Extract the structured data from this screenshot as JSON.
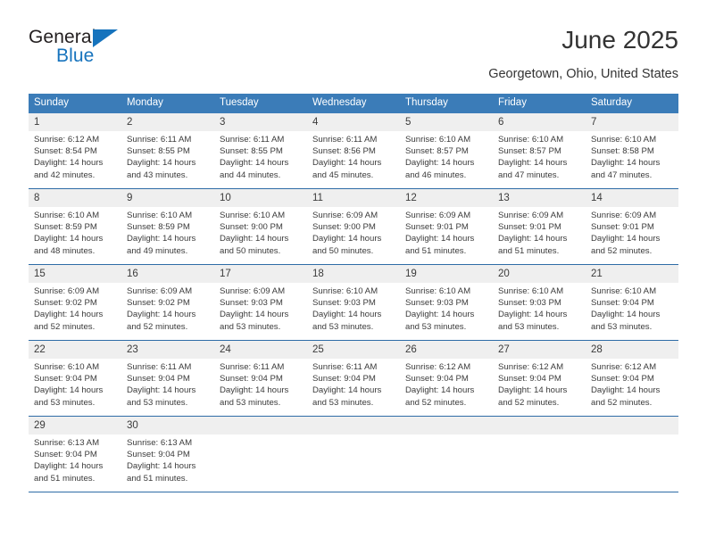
{
  "logo": {
    "word1": "General",
    "word2": "Blue",
    "triangle_color": "#1673bd",
    "icon": "blue-triangle-icon"
  },
  "header": {
    "title": "June 2025",
    "subtitle": "Georgetown, Ohio, United States"
  },
  "theme": {
    "header_blue": "#3b7cb8",
    "rule_blue": "#2e6ca6",
    "daynum_gray": "#efefef",
    "text": "#3b3b3b"
  },
  "calendar": {
    "weekday_headers": [
      "Sunday",
      "Monday",
      "Tuesday",
      "Wednesday",
      "Thursday",
      "Friday",
      "Saturday"
    ],
    "weeks": [
      [
        {
          "day": "1",
          "sunrise": "Sunrise: 6:12 AM",
          "sunset": "Sunset: 8:54 PM",
          "daylight1": "Daylight: 14 hours",
          "daylight2": "and 42 minutes."
        },
        {
          "day": "2",
          "sunrise": "Sunrise: 6:11 AM",
          "sunset": "Sunset: 8:55 PM",
          "daylight1": "Daylight: 14 hours",
          "daylight2": "and 43 minutes."
        },
        {
          "day": "3",
          "sunrise": "Sunrise: 6:11 AM",
          "sunset": "Sunset: 8:55 PM",
          "daylight1": "Daylight: 14 hours",
          "daylight2": "and 44 minutes."
        },
        {
          "day": "4",
          "sunrise": "Sunrise: 6:11 AM",
          "sunset": "Sunset: 8:56 PM",
          "daylight1": "Daylight: 14 hours",
          "daylight2": "and 45 minutes."
        },
        {
          "day": "5",
          "sunrise": "Sunrise: 6:10 AM",
          "sunset": "Sunset: 8:57 PM",
          "daylight1": "Daylight: 14 hours",
          "daylight2": "and 46 minutes."
        },
        {
          "day": "6",
          "sunrise": "Sunrise: 6:10 AM",
          "sunset": "Sunset: 8:57 PM",
          "daylight1": "Daylight: 14 hours",
          "daylight2": "and 47 minutes."
        },
        {
          "day": "7",
          "sunrise": "Sunrise: 6:10 AM",
          "sunset": "Sunset: 8:58 PM",
          "daylight1": "Daylight: 14 hours",
          "daylight2": "and 47 minutes."
        }
      ],
      [
        {
          "day": "8",
          "sunrise": "Sunrise: 6:10 AM",
          "sunset": "Sunset: 8:59 PM",
          "daylight1": "Daylight: 14 hours",
          "daylight2": "and 48 minutes."
        },
        {
          "day": "9",
          "sunrise": "Sunrise: 6:10 AM",
          "sunset": "Sunset: 8:59 PM",
          "daylight1": "Daylight: 14 hours",
          "daylight2": "and 49 minutes."
        },
        {
          "day": "10",
          "sunrise": "Sunrise: 6:10 AM",
          "sunset": "Sunset: 9:00 PM",
          "daylight1": "Daylight: 14 hours",
          "daylight2": "and 50 minutes."
        },
        {
          "day": "11",
          "sunrise": "Sunrise: 6:09 AM",
          "sunset": "Sunset: 9:00 PM",
          "daylight1": "Daylight: 14 hours",
          "daylight2": "and 50 minutes."
        },
        {
          "day": "12",
          "sunrise": "Sunrise: 6:09 AM",
          "sunset": "Sunset: 9:01 PM",
          "daylight1": "Daylight: 14 hours",
          "daylight2": "and 51 minutes."
        },
        {
          "day": "13",
          "sunrise": "Sunrise: 6:09 AM",
          "sunset": "Sunset: 9:01 PM",
          "daylight1": "Daylight: 14 hours",
          "daylight2": "and 51 minutes."
        },
        {
          "day": "14",
          "sunrise": "Sunrise: 6:09 AM",
          "sunset": "Sunset: 9:01 PM",
          "daylight1": "Daylight: 14 hours",
          "daylight2": "and 52 minutes."
        }
      ],
      [
        {
          "day": "15",
          "sunrise": "Sunrise: 6:09 AM",
          "sunset": "Sunset: 9:02 PM",
          "daylight1": "Daylight: 14 hours",
          "daylight2": "and 52 minutes."
        },
        {
          "day": "16",
          "sunrise": "Sunrise: 6:09 AM",
          "sunset": "Sunset: 9:02 PM",
          "daylight1": "Daylight: 14 hours",
          "daylight2": "and 52 minutes."
        },
        {
          "day": "17",
          "sunrise": "Sunrise: 6:09 AM",
          "sunset": "Sunset: 9:03 PM",
          "daylight1": "Daylight: 14 hours",
          "daylight2": "and 53 minutes."
        },
        {
          "day": "18",
          "sunrise": "Sunrise: 6:10 AM",
          "sunset": "Sunset: 9:03 PM",
          "daylight1": "Daylight: 14 hours",
          "daylight2": "and 53 minutes."
        },
        {
          "day": "19",
          "sunrise": "Sunrise: 6:10 AM",
          "sunset": "Sunset: 9:03 PM",
          "daylight1": "Daylight: 14 hours",
          "daylight2": "and 53 minutes."
        },
        {
          "day": "20",
          "sunrise": "Sunrise: 6:10 AM",
          "sunset": "Sunset: 9:03 PM",
          "daylight1": "Daylight: 14 hours",
          "daylight2": "and 53 minutes."
        },
        {
          "day": "21",
          "sunrise": "Sunrise: 6:10 AM",
          "sunset": "Sunset: 9:04 PM",
          "daylight1": "Daylight: 14 hours",
          "daylight2": "and 53 minutes."
        }
      ],
      [
        {
          "day": "22",
          "sunrise": "Sunrise: 6:10 AM",
          "sunset": "Sunset: 9:04 PM",
          "daylight1": "Daylight: 14 hours",
          "daylight2": "and 53 minutes."
        },
        {
          "day": "23",
          "sunrise": "Sunrise: 6:11 AM",
          "sunset": "Sunset: 9:04 PM",
          "daylight1": "Daylight: 14 hours",
          "daylight2": "and 53 minutes."
        },
        {
          "day": "24",
          "sunrise": "Sunrise: 6:11 AM",
          "sunset": "Sunset: 9:04 PM",
          "daylight1": "Daylight: 14 hours",
          "daylight2": "and 53 minutes."
        },
        {
          "day": "25",
          "sunrise": "Sunrise: 6:11 AM",
          "sunset": "Sunset: 9:04 PM",
          "daylight1": "Daylight: 14 hours",
          "daylight2": "and 53 minutes."
        },
        {
          "day": "26",
          "sunrise": "Sunrise: 6:12 AM",
          "sunset": "Sunset: 9:04 PM",
          "daylight1": "Daylight: 14 hours",
          "daylight2": "and 52 minutes."
        },
        {
          "day": "27",
          "sunrise": "Sunrise: 6:12 AM",
          "sunset": "Sunset: 9:04 PM",
          "daylight1": "Daylight: 14 hours",
          "daylight2": "and 52 minutes."
        },
        {
          "day": "28",
          "sunrise": "Sunrise: 6:12 AM",
          "sunset": "Sunset: 9:04 PM",
          "daylight1": "Daylight: 14 hours",
          "daylight2": "and 52 minutes."
        }
      ],
      [
        {
          "day": "29",
          "sunrise": "Sunrise: 6:13 AM",
          "sunset": "Sunset: 9:04 PM",
          "daylight1": "Daylight: 14 hours",
          "daylight2": "and 51 minutes."
        },
        {
          "day": "30",
          "sunrise": "Sunrise: 6:13 AM",
          "sunset": "Sunset: 9:04 PM",
          "daylight1": "Daylight: 14 hours",
          "daylight2": "and 51 minutes."
        },
        {
          "day": "",
          "sunrise": "",
          "sunset": "",
          "daylight1": "",
          "daylight2": ""
        },
        {
          "day": "",
          "sunrise": "",
          "sunset": "",
          "daylight1": "",
          "daylight2": ""
        },
        {
          "day": "",
          "sunrise": "",
          "sunset": "",
          "daylight1": "",
          "daylight2": ""
        },
        {
          "day": "",
          "sunrise": "",
          "sunset": "",
          "daylight1": "",
          "daylight2": ""
        },
        {
          "day": "",
          "sunrise": "",
          "sunset": "",
          "daylight1": "",
          "daylight2": ""
        }
      ]
    ]
  }
}
